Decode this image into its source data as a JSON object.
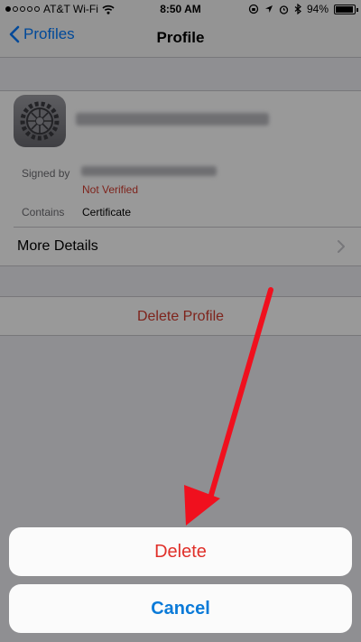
{
  "status_bar": {
    "carrier": "AT&T Wi-Fi",
    "time": "8:50 AM",
    "battery_percent": "94%",
    "battery_level": 0.94,
    "signal_dots_filled": 1,
    "signal_dots_total": 5
  },
  "nav": {
    "back_label": "Profiles",
    "title": "Profile"
  },
  "profile": {
    "signed_by_label": "Signed by",
    "verification_status": "Not Verified",
    "contains_label": "Contains",
    "contains_value": "Certificate",
    "more_details_label": "More Details"
  },
  "delete_profile_label": "Delete Profile",
  "action_sheet": {
    "delete_label": "Delete",
    "cancel_label": "Cancel"
  },
  "colors": {
    "ios_blue": "#007aff",
    "destructive_red": "#e0302a",
    "annotation_arrow": "#f0101e"
  }
}
